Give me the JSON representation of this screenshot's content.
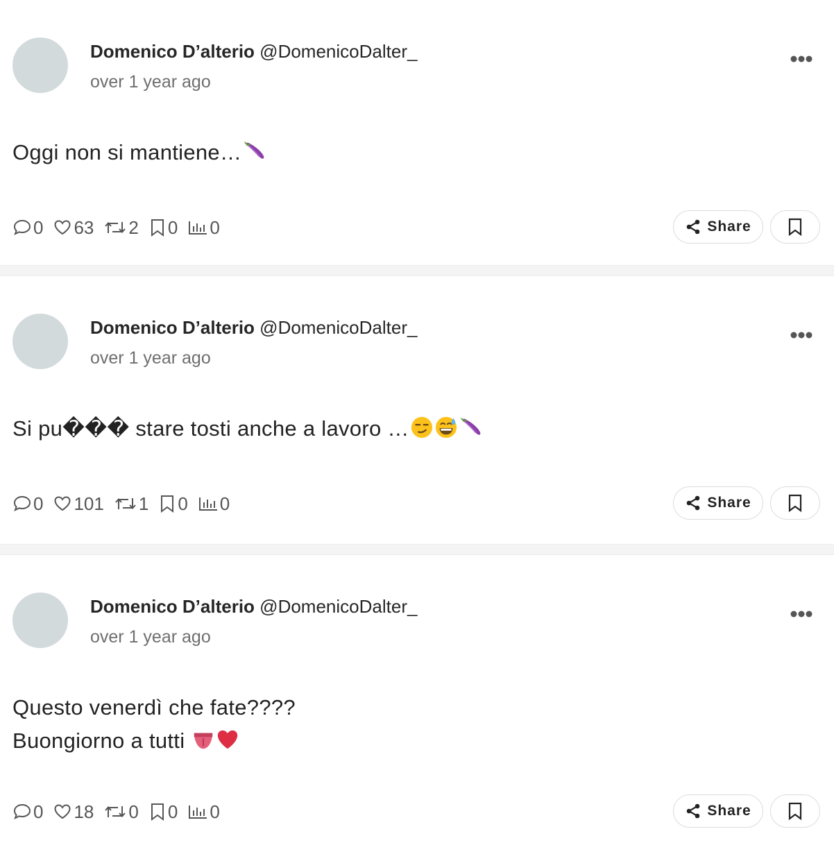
{
  "posts": [
    {
      "author_name": "Domenico D’alterio",
      "author_handle": "@DomenicoDalter_",
      "timestamp": "over 1 year ago",
      "text": "Oggi non si mantiene…",
      "emojis": [
        "eggplant"
      ],
      "stats": {
        "comments": "0",
        "likes": "63",
        "reposts": "2",
        "bookmarks": "0",
        "views": "0"
      },
      "share_label": "Share"
    },
    {
      "author_name": "Domenico D’alterio",
      "author_handle": "@DomenicoDalter_",
      "timestamp": "over 1 year ago",
      "text_before": "Si pu",
      "replacement_chars": "���",
      "text_after": " stare tosti anche a lavoro …",
      "emojis": [
        "smirking-face",
        "grinning-sweat-face",
        "eggplant"
      ],
      "stats": {
        "comments": "0",
        "likes": "101",
        "reposts": "1",
        "bookmarks": "0",
        "views": "0"
      },
      "share_label": "Share"
    },
    {
      "author_name": "Domenico D’alterio",
      "author_handle": "@DomenicoDalter_",
      "timestamp": "over 1 year ago",
      "text_line1": "Questo venerdì che fate????",
      "text_line2": "Buongiorno a tutti ",
      "emojis": [
        "tongue",
        "red-heart"
      ],
      "stats": {
        "comments": "0",
        "likes": "18",
        "reposts": "0",
        "bookmarks": "0",
        "views": "0"
      },
      "share_label": "Share"
    }
  ],
  "colors": {
    "avatar_placeholder": "#d3dadc",
    "separator": "#f4f4f4",
    "muted_text": "#6e6e6e",
    "icon": "#555555"
  }
}
